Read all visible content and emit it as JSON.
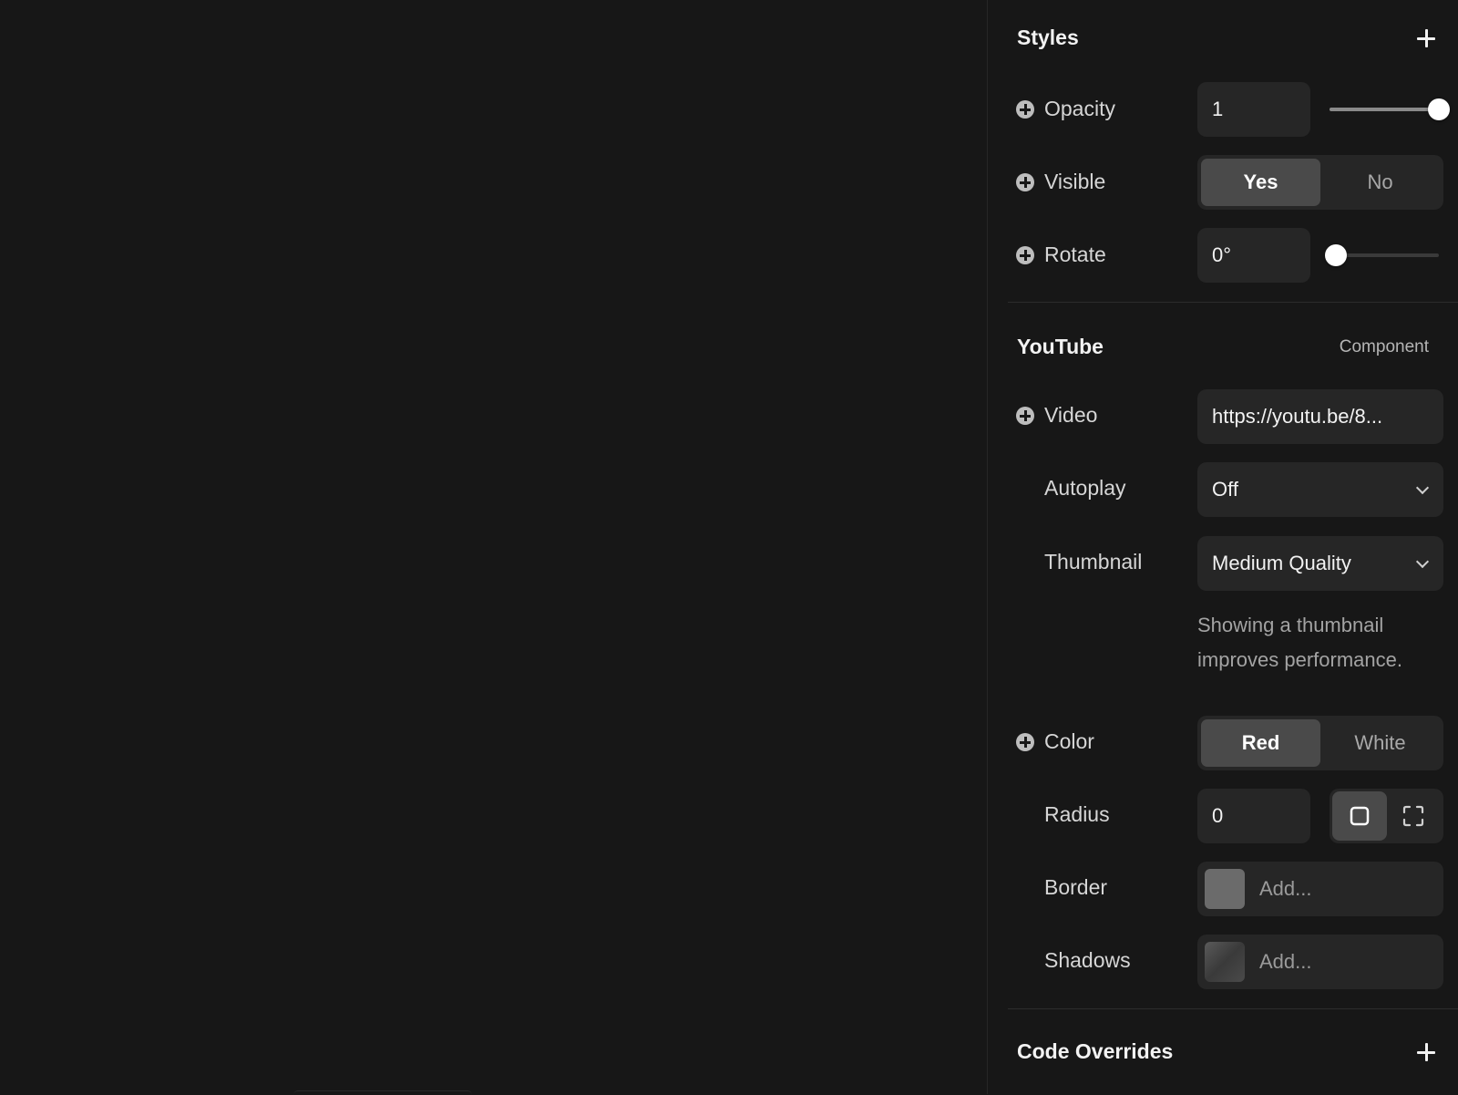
{
  "styles": {
    "title": "Styles",
    "opacity": {
      "label": "Opacity",
      "value": "1",
      "slider_level": 1.0
    },
    "visible": {
      "label": "Visible",
      "options": [
        "Yes",
        "No"
      ],
      "selected": "Yes"
    },
    "rotate": {
      "label": "Rotate",
      "value": "0°",
      "slider_level": 0.0
    }
  },
  "youtube": {
    "title": "YouTube",
    "tag": "Component",
    "video": {
      "label": "Video",
      "value": "https://youtu.be/8..."
    },
    "autoplay": {
      "label": "Autoplay",
      "value": "Off"
    },
    "thumbnail": {
      "label": "Thumbnail",
      "value": "Medium Quality",
      "hint": "Showing a thumbnail improves performance."
    },
    "color": {
      "label": "Color",
      "options": [
        "Red",
        "White"
      ],
      "selected": "Red"
    },
    "radius": {
      "label": "Radius",
      "value": "0",
      "mode_selected": "uniform"
    },
    "border": {
      "label": "Border",
      "placeholder": "Add...",
      "swatch_color": "#6b6b6b"
    },
    "shadows": {
      "label": "Shadows",
      "placeholder": "Add..."
    }
  },
  "code_overrides": {
    "title": "Code Overrides"
  },
  "icons": {
    "add_section": "plus-icon",
    "add_property": "plus-circle-icon",
    "dropdown": "chevron-down-icon",
    "radius_uniform": "square-icon",
    "radius_individual": "corners-icon"
  },
  "colors": {
    "background": "#171717",
    "control": "#262626",
    "active_segment": "#4a4a4a"
  }
}
